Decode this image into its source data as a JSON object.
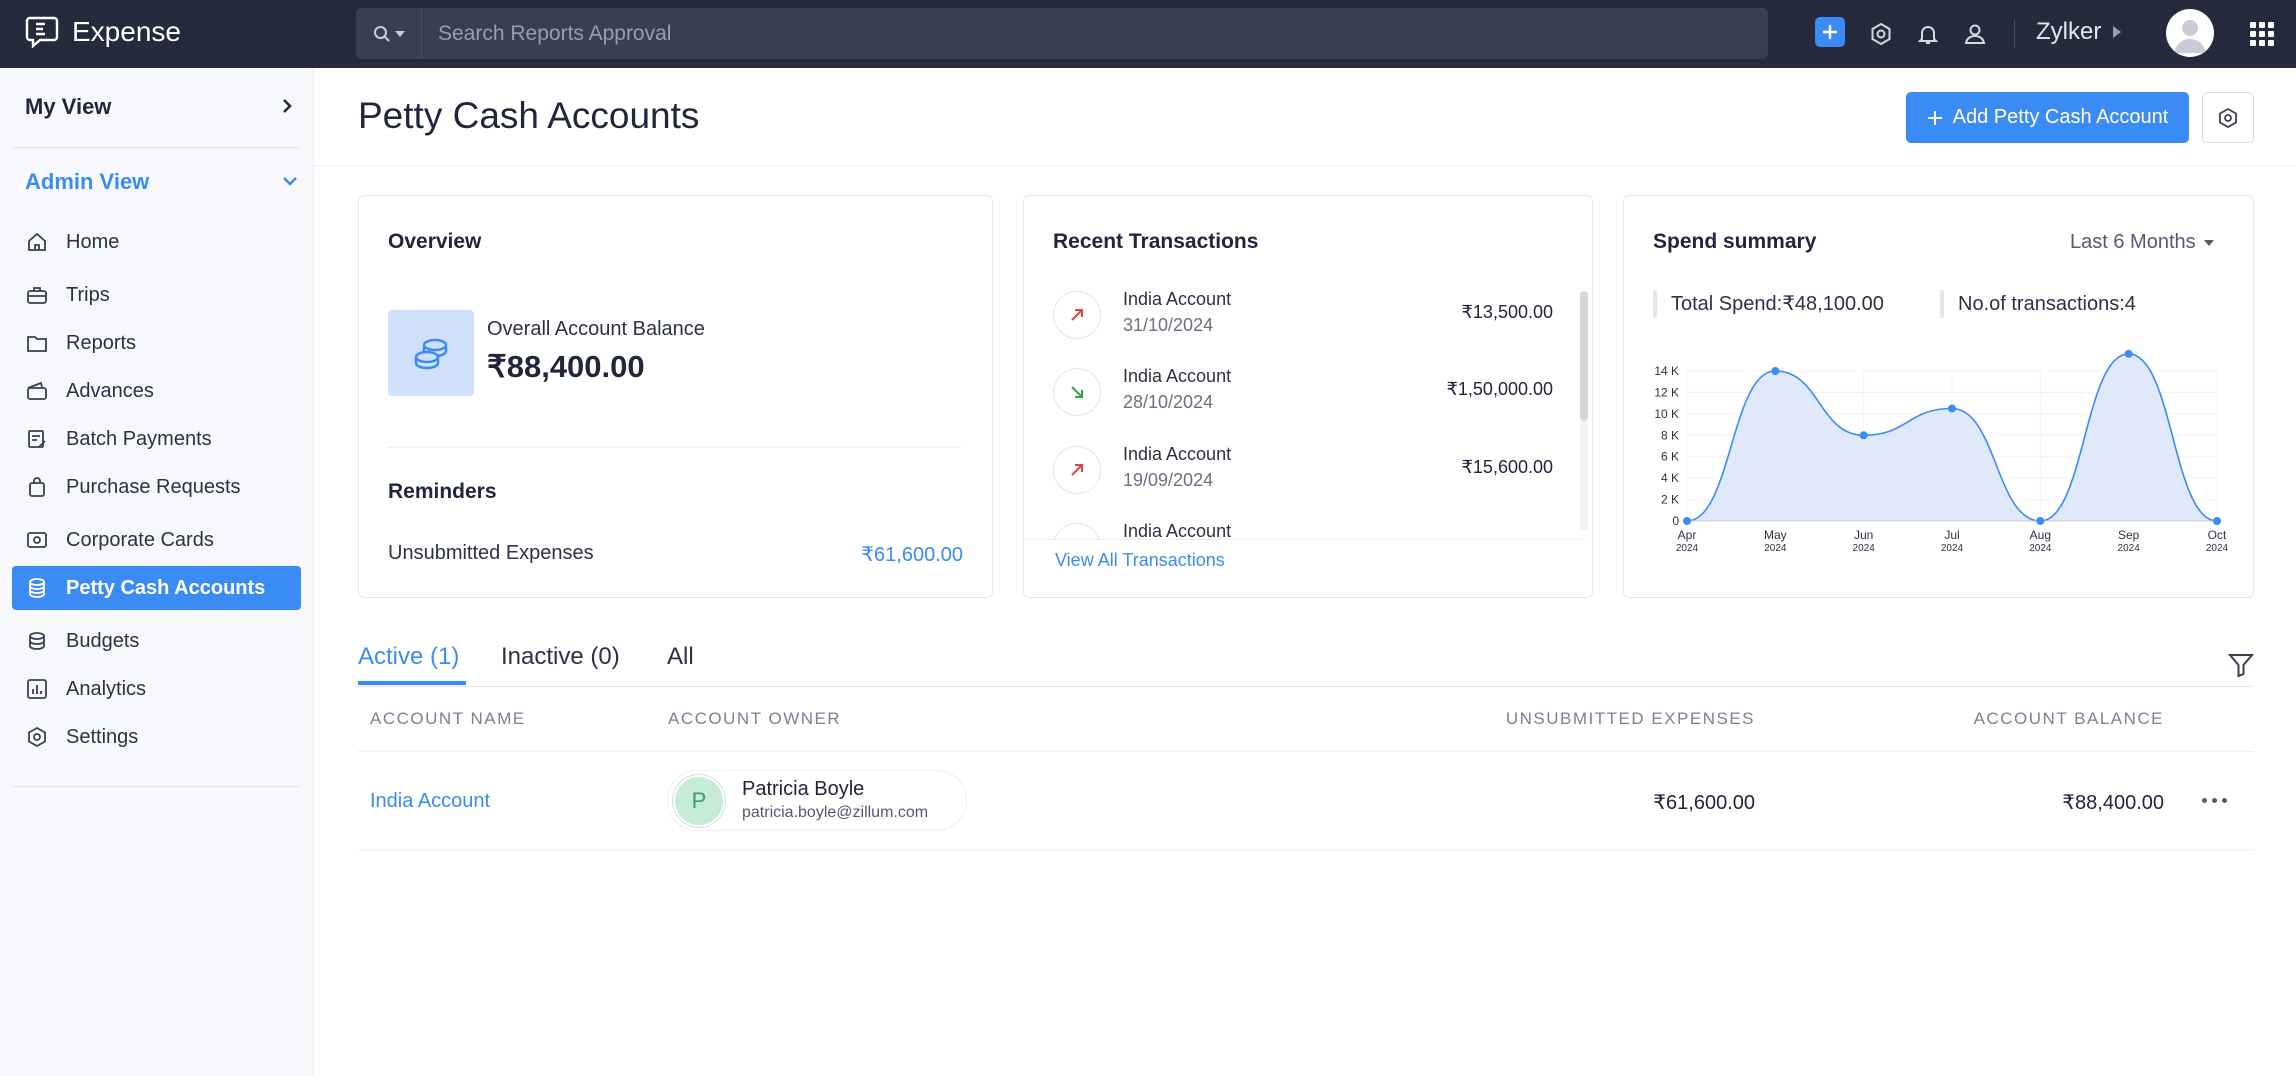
{
  "app": {
    "name": "Expense"
  },
  "search": {
    "placeholder": "Search Reports Approval"
  },
  "topbar": {
    "org_name": "Zylker"
  },
  "sidebar": {
    "my_view": "My View",
    "admin_view": "Admin View",
    "items": [
      {
        "label": "Home",
        "icon": "home-icon"
      },
      {
        "label": "Trips",
        "icon": "suitcase-icon"
      },
      {
        "label": "Reports",
        "icon": "folder-icon"
      },
      {
        "label": "Advances",
        "icon": "wallet-icon"
      },
      {
        "label": "Batch Payments",
        "icon": "batch-payments-icon"
      },
      {
        "label": "Purchase Requests",
        "icon": "bag-icon"
      },
      {
        "label": "Corporate Cards",
        "icon": "card-icon"
      },
      {
        "label": "Petty Cash Accounts",
        "icon": "coins-icon",
        "active": true
      },
      {
        "label": "Budgets",
        "icon": "budget-icon"
      },
      {
        "label": "Analytics",
        "icon": "analytics-icon"
      },
      {
        "label": "Settings",
        "icon": "gear-icon"
      }
    ]
  },
  "page": {
    "title": "Petty Cash Accounts",
    "add_button": "Add Petty Cash Account"
  },
  "overview": {
    "title": "Overview",
    "balance_label": "Overall Account Balance",
    "balance_value": "₹88,400.00",
    "reminders_title": "Reminders",
    "unsubmitted_label": "Unsubmitted Expenses",
    "unsubmitted_value": "₹61,600.00"
  },
  "transactions": {
    "title": "Recent Transactions",
    "items": [
      {
        "name": "India Account",
        "date": "31/10/2024",
        "amount": "₹13,500.00",
        "direction": "out"
      },
      {
        "name": "India Account",
        "date": "28/10/2024",
        "amount": "₹1,50,000.00",
        "direction": "in"
      },
      {
        "name": "India Account",
        "date": "19/09/2024",
        "amount": "₹15,600.00",
        "direction": "out"
      },
      {
        "name": "India Account",
        "date": "",
        "amount": "",
        "direction": "out"
      }
    ],
    "view_all": "View All Transactions"
  },
  "spend_summary": {
    "title": "Spend summary",
    "period": "Last 6 Months",
    "total_spend": "Total Spend:₹48,100.00",
    "transactions_count": "No.of transactions:4"
  },
  "chart_data": {
    "type": "area",
    "categories": [
      "Apr",
      "May",
      "Jun",
      "Jul",
      "Aug",
      "Sep",
      "Oct"
    ],
    "years": [
      "2024",
      "2024",
      "2024",
      "2024",
      "2024",
      "2024",
      "2024"
    ],
    "values": [
      0,
      14000,
      8000,
      10500,
      0,
      15600,
      0
    ],
    "y_ticks": [
      "0",
      "2 K",
      "4 K",
      "6 K",
      "8 K",
      "10 K",
      "12 K",
      "14 K"
    ],
    "ylim": [
      0,
      14000
    ],
    "grid": true,
    "colors": {
      "line": "#3b8bf4",
      "fill": "#dbe7fb"
    }
  },
  "tabs": [
    {
      "label": "Active (1)",
      "active": true
    },
    {
      "label": "Inactive (0)"
    },
    {
      "label": "All"
    }
  ],
  "table": {
    "headers": [
      "ACCOUNT NAME",
      "ACCOUNT OWNER",
      "UNSUBMITTED EXPENSES",
      "ACCOUNT BALANCE"
    ],
    "rows": [
      {
        "account_name": "India Account",
        "owner_initial": "P",
        "owner_name": "Patricia Boyle",
        "owner_email": "patricia.boyle@zillum.com",
        "unsubmitted": "₹61,600.00",
        "balance": "₹88,400.00"
      }
    ]
  },
  "colors": {
    "accent": "#3b8bf4",
    "topbar": "#262a3c",
    "sidebar": "#f7f8fb"
  }
}
